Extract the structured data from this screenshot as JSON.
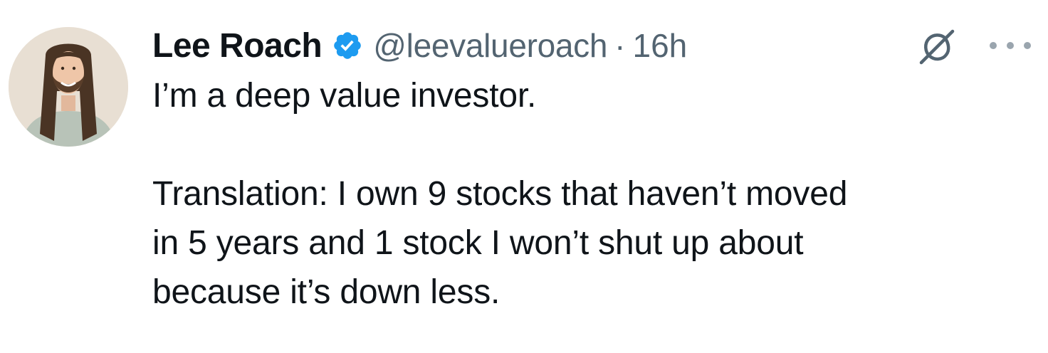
{
  "tweet": {
    "author": {
      "name": "Lee Roach",
      "handle": "@leevalueroach",
      "separator": "·",
      "time": "16h",
      "verified": true,
      "verified_color": "#1d9bf0"
    },
    "text": {
      "paragraph1": "I’m a deep value investor.",
      "paragraph2_lines": [
        "Translation: I own 9 stocks that haven’t moved",
        "in 5 years and 1 stock I won’t shut up about",
        "because it’s down less."
      ]
    },
    "icons": {
      "grok": "grok-icon",
      "more": "more-options-icon",
      "verified": "verified-badge-icon"
    }
  }
}
